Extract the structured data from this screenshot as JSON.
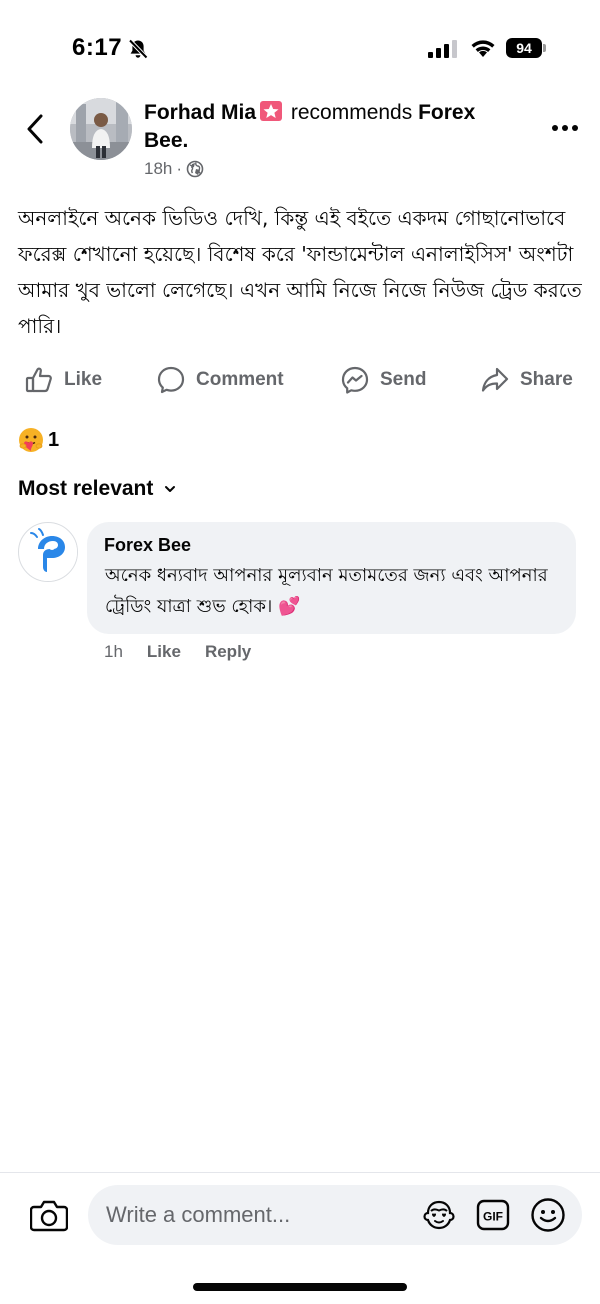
{
  "status_bar": {
    "time": "6:17",
    "battery": "94",
    "icons": [
      "bell-slash-icon",
      "signal-icon",
      "wifi-icon",
      "battery-icon"
    ]
  },
  "header": {
    "author_name": "Forhad Mia",
    "verb": "recommends",
    "page_name": "Forex",
    "page_name_cont": "Bee.",
    "time": "18h",
    "separator": "·",
    "icons": [
      "back-arrow-icon",
      "top-fan-badge-icon",
      "globe-icon",
      "more-dots-icon"
    ]
  },
  "post": {
    "text": "অনলাইনে অনেক ভিডিও দেখি, কিন্তু এই বইতে একদম গোছানোভাবে ফরেক্স শেখানো হয়েছে। বিশেষ করে 'ফান্ডামেন্টাল এনালাইসিস' অংশটা আমার খুব ভালো লেগেছে। এখন আমি নিজে নিজে নিউজ ট্রেড করতে পারি।"
  },
  "actions": {
    "like": "Like",
    "comment": "Comment",
    "send": "Send",
    "share": "Share"
  },
  "reactions": {
    "count": "1",
    "icon": "care-reaction-icon"
  },
  "sort": {
    "label": "Most relevant"
  },
  "comments": [
    {
      "author": "Forex Bee",
      "text": "অনেক ধন্যবাদ আপনার মূল্যবান মতামতের জন্য এবং আপনার ট্রেডিং  যাত্রা শুভ হোক। ",
      "emoji": "💕",
      "time": "1h",
      "like": "Like",
      "reply": "Reply"
    }
  ],
  "composer": {
    "placeholder": "Write a comment...",
    "icons": [
      "camera-icon",
      "avatar-sticker-icon",
      "gif-icon",
      "emoji-icon"
    ]
  },
  "colors": {
    "text_primary": "#050505",
    "text_secondary": "#65676b",
    "bubble_bg": "#f0f2f5",
    "brand_blue": "#1877f2",
    "badge_pink": "#f0587a",
    "page_logo_blue": "#2a87e8"
  }
}
